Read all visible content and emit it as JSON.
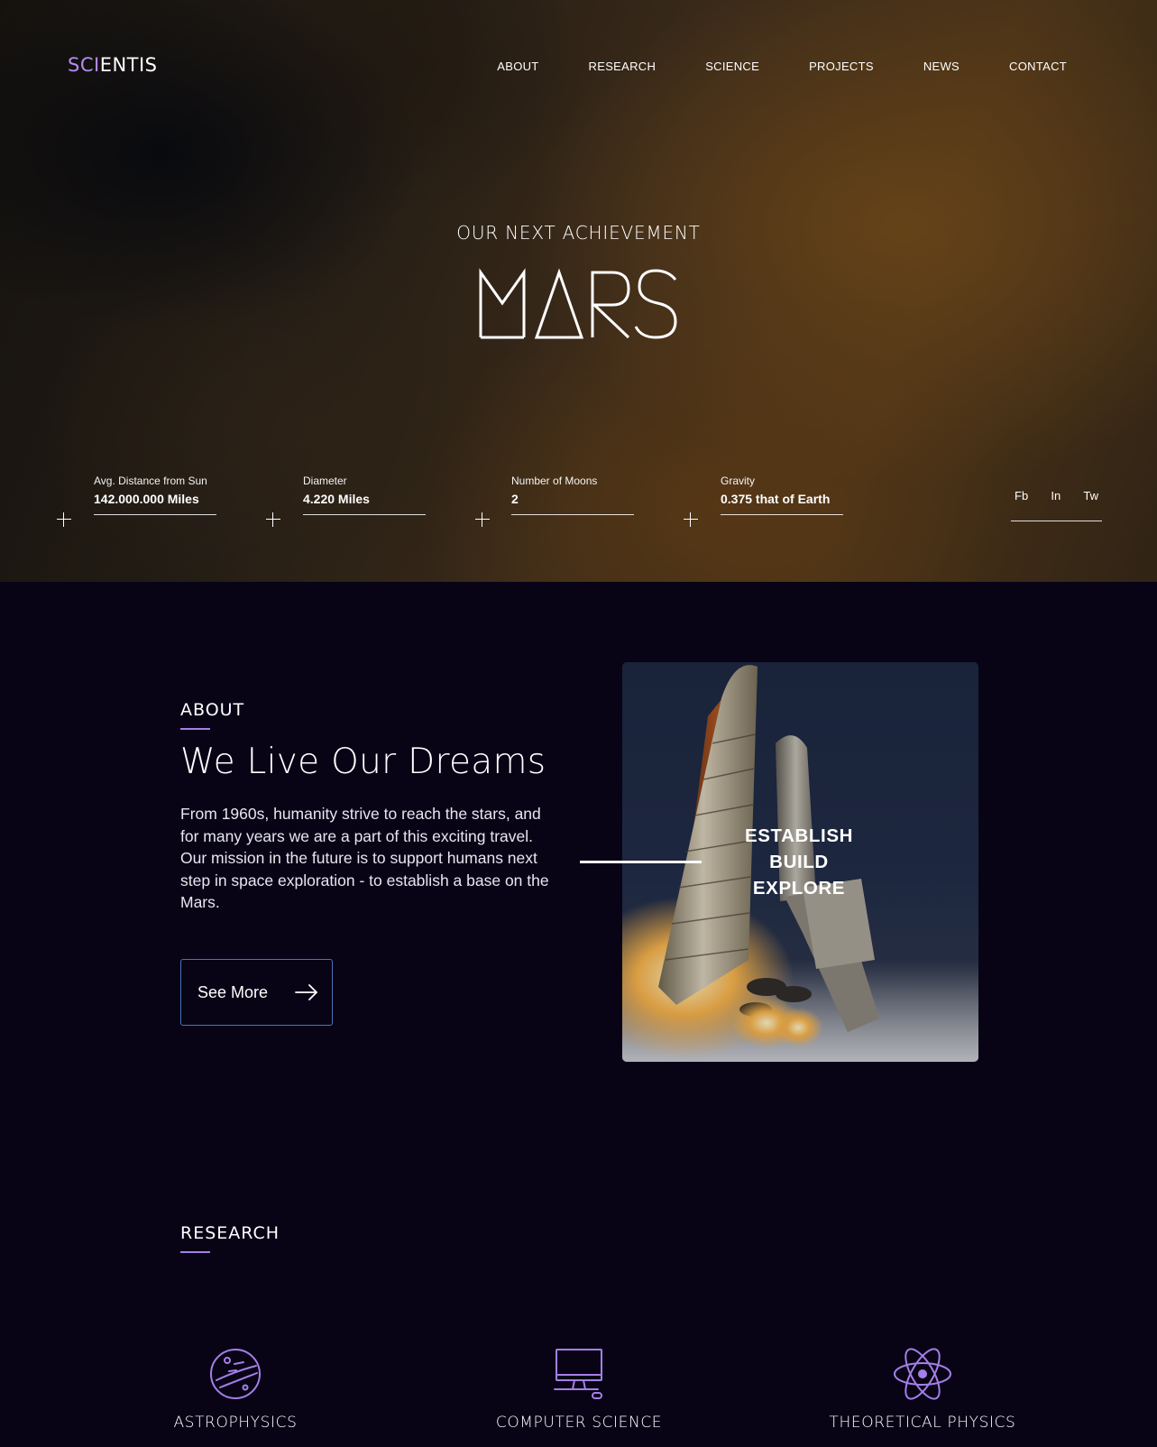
{
  "brand": {
    "logo_accent": "SCI",
    "logo_rest": "ENTIS",
    "accent_color": "#b48cf0"
  },
  "nav": {
    "items": [
      {
        "label": "ABOUT"
      },
      {
        "label": "RESEARCH"
      },
      {
        "label": "SCIENCE"
      },
      {
        "label": "PROJECTS"
      },
      {
        "label": "NEWS"
      },
      {
        "label": "CONTACT"
      }
    ]
  },
  "hero": {
    "eyebrow": "OUR NEXT ACHIEVEMENT",
    "title": "MARS",
    "stats": [
      {
        "label": "Avg. Distance from Sun",
        "value": "142.000.000 Miles"
      },
      {
        "label": "Diameter",
        "value": "4.220 Miles"
      },
      {
        "label": "Number of Moons",
        "value": "2"
      },
      {
        "label": "Gravity",
        "value": "0.375 that of Earth"
      }
    ],
    "social": [
      {
        "label": "Fb"
      },
      {
        "label": "In"
      },
      {
        "label": "Tw"
      }
    ]
  },
  "about": {
    "label": "ABOUT",
    "heading": "We Live Our Dreams",
    "body": "From 1960s, humanity strive to reach the stars, and for many years we are a part of this exciting travel. Our mission in the future is to support humans next step in space exploration - to establish a base on the Mars.",
    "button_label": "See More",
    "motto": [
      "ESTABLISH",
      "BUILD",
      "EXPLORE"
    ]
  },
  "research": {
    "label": "RESEARCH",
    "items": [
      {
        "label": "ASTROPHYSICS",
        "icon": "planet-icon"
      },
      {
        "label": "COMPUTER SCIENCE",
        "icon": "computer-icon"
      },
      {
        "label": "THEORETICAL PHYSICS",
        "icon": "atom-icon"
      }
    ]
  },
  "colors": {
    "background": "#080416",
    "underline": "#a57fe8",
    "button_border": "#4a72b8"
  }
}
